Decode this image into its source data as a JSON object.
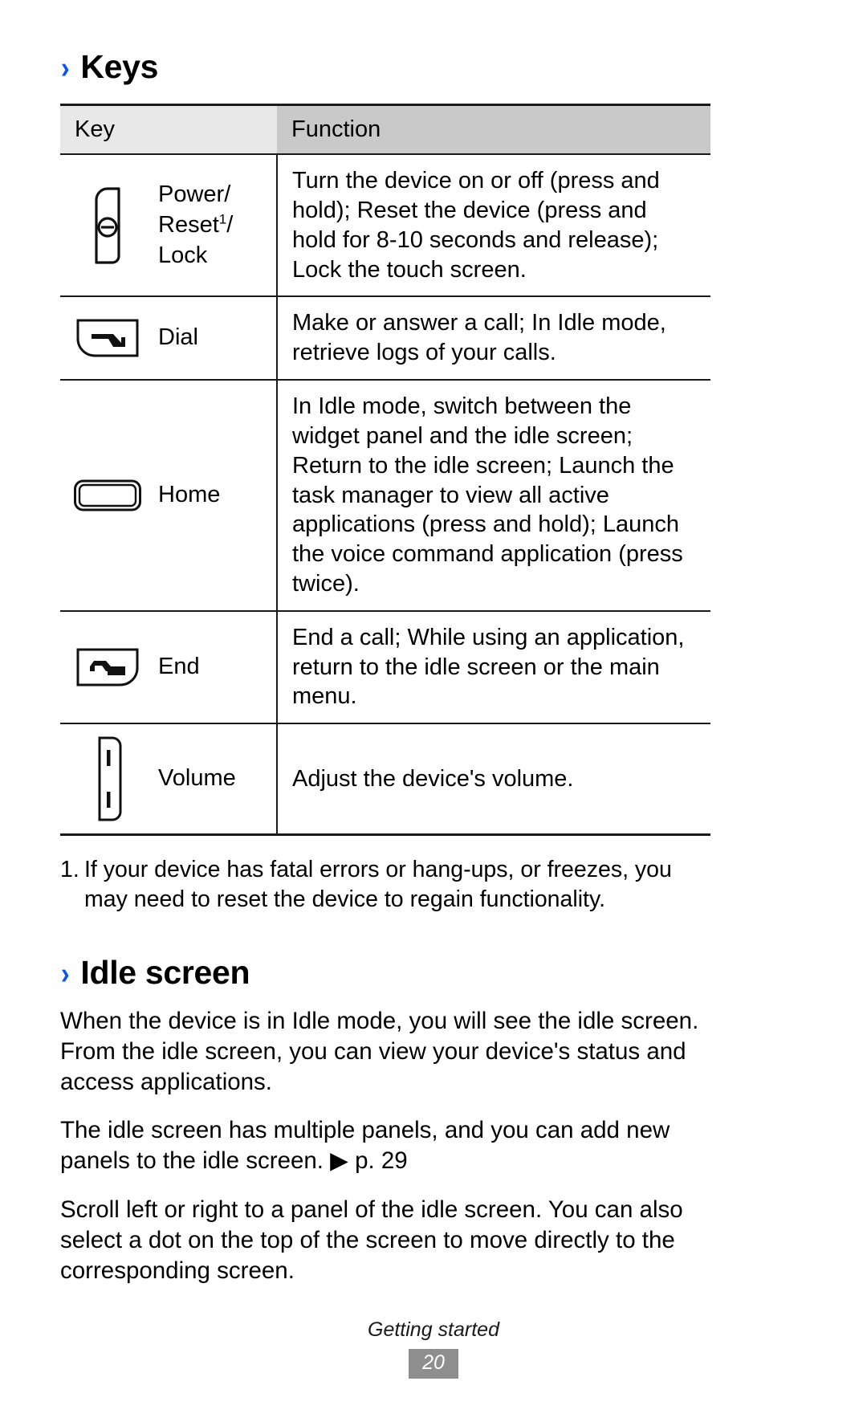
{
  "page": {
    "heading_chevron": "›",
    "footer_chapter": "Getting started",
    "footer_page_number": "20"
  },
  "keys_section": {
    "title": "Keys",
    "table": {
      "columns": [
        "Key",
        "Function"
      ],
      "rows": [
        {
          "icon": "power-key-icon",
          "label_lines": [
            "Power/",
            "Reset",
            "Lock"
          ],
          "label_superscript": "1",
          "function": "Turn the device on or off (press and hold); Reset the device (press and hold for 8-10 seconds and release); Lock the touch screen."
        },
        {
          "icon": "dial-key-icon",
          "label_lines": [
            "Dial"
          ],
          "label_superscript": "",
          "function": "Make or answer a call; In Idle mode, retrieve logs of your calls."
        },
        {
          "icon": "home-key-icon",
          "label_lines": [
            "Home"
          ],
          "label_superscript": "",
          "function": "In Idle mode, switch between the widget panel and the idle screen; Return to the idle screen; Launch the task manager to view all active applications (press and hold); Launch the voice command application (press twice)."
        },
        {
          "icon": "end-key-icon",
          "label_lines": [
            "End"
          ],
          "label_superscript": "",
          "function": "End a call; While using an application, return to the idle screen or the main menu."
        },
        {
          "icon": "volume-key-icon",
          "label_lines": [
            "Volume"
          ],
          "label_superscript": "",
          "function": "Adjust the device's volume."
        }
      ]
    },
    "footnote": {
      "number": "1.",
      "text": "If your device has fatal errors or hang-ups, or freezes, you may need to reset the device to regain functionality."
    }
  },
  "idle_section": {
    "title": "Idle screen",
    "paragraphs": [
      "When the device is in Idle mode, you will see the idle screen. From the idle screen, you can view your device's status and access applications.",
      "The idle screen has multiple panels, and you can add new panels to the idle screen. ▶ p. 29",
      "Scroll left or right to a panel of the idle screen. You can also select a dot on the top of the screen to move directly to the corresponding screen."
    ]
  },
  "colors": {
    "accent_blue": "#0b54f0",
    "header_key_bg": "#e8e8e8",
    "header_function_bg": "#c9c9c9",
    "page_badge_bg": "#8e8e8e",
    "rule": "#1a1a1a"
  }
}
